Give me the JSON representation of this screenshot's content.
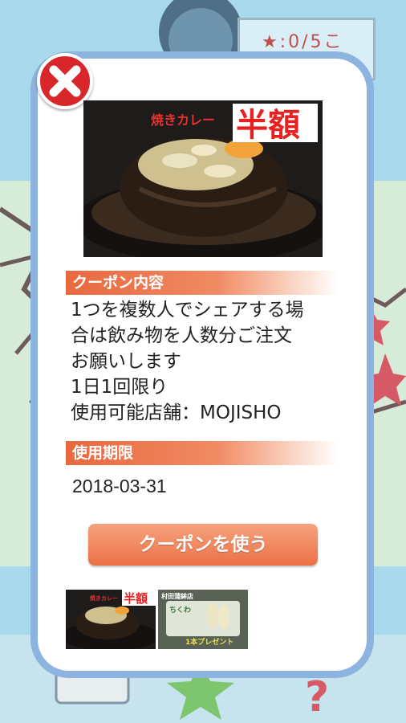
{
  "background": {
    "counter_text": "★:0/5こ",
    "colors": {
      "sky": "#a9d9ec",
      "map": "#d6ecd9"
    }
  },
  "modal": {
    "close_icon": "close-x-icon",
    "hero": {
      "caption_small": "焼きカレー",
      "caption_big": "半額"
    },
    "content_header": "クーポン内容",
    "content_text": "1つを複数人でシェアする場\n合は飲み物を人数分ご注文\nお願いします\n1日1回限り\n使用可能店舗：MOJISHO",
    "expiry_header": "使用期限",
    "expiry_value": "2018-03-31",
    "use_button_label": "クーポンを使う",
    "thumbnails": [
      {
        "caption_small": "焼きカレー",
        "caption_big": "半額"
      },
      {
        "caption_top": "村田蒲鉾店",
        "caption_sub": "ちくわ",
        "caption_bottom": "1本プレゼント"
      }
    ],
    "colors": {
      "border": "#8db3df",
      "accent": "#ec7146",
      "close": "#d8262b"
    }
  }
}
